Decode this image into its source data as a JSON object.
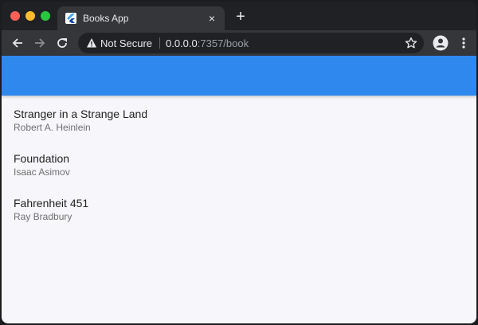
{
  "browser": {
    "tab": {
      "title": "Books App",
      "close_glyph": "×",
      "favicon": "flutter-icon"
    },
    "new_tab_glyph": "+",
    "security_label": "Not Secure",
    "url_host": "0.0.0.0",
    "url_rest": ":7357/book",
    "icons": {
      "back": "back-arrow-icon",
      "forward": "forward-arrow-icon",
      "reload": "reload-icon",
      "warning": "warning-icon",
      "bookmark": "star-icon",
      "profile": "account-icon",
      "menu": "more-vert-icon"
    }
  },
  "app": {
    "appbar_color": "#2f88ee",
    "books": [
      {
        "title": "Stranger in a Strange Land",
        "author": "Robert A. Heinlein"
      },
      {
        "title": "Foundation",
        "author": "Isaac Asimov"
      },
      {
        "title": "Fahrenheit 451",
        "author": "Ray Bradbury"
      }
    ]
  }
}
